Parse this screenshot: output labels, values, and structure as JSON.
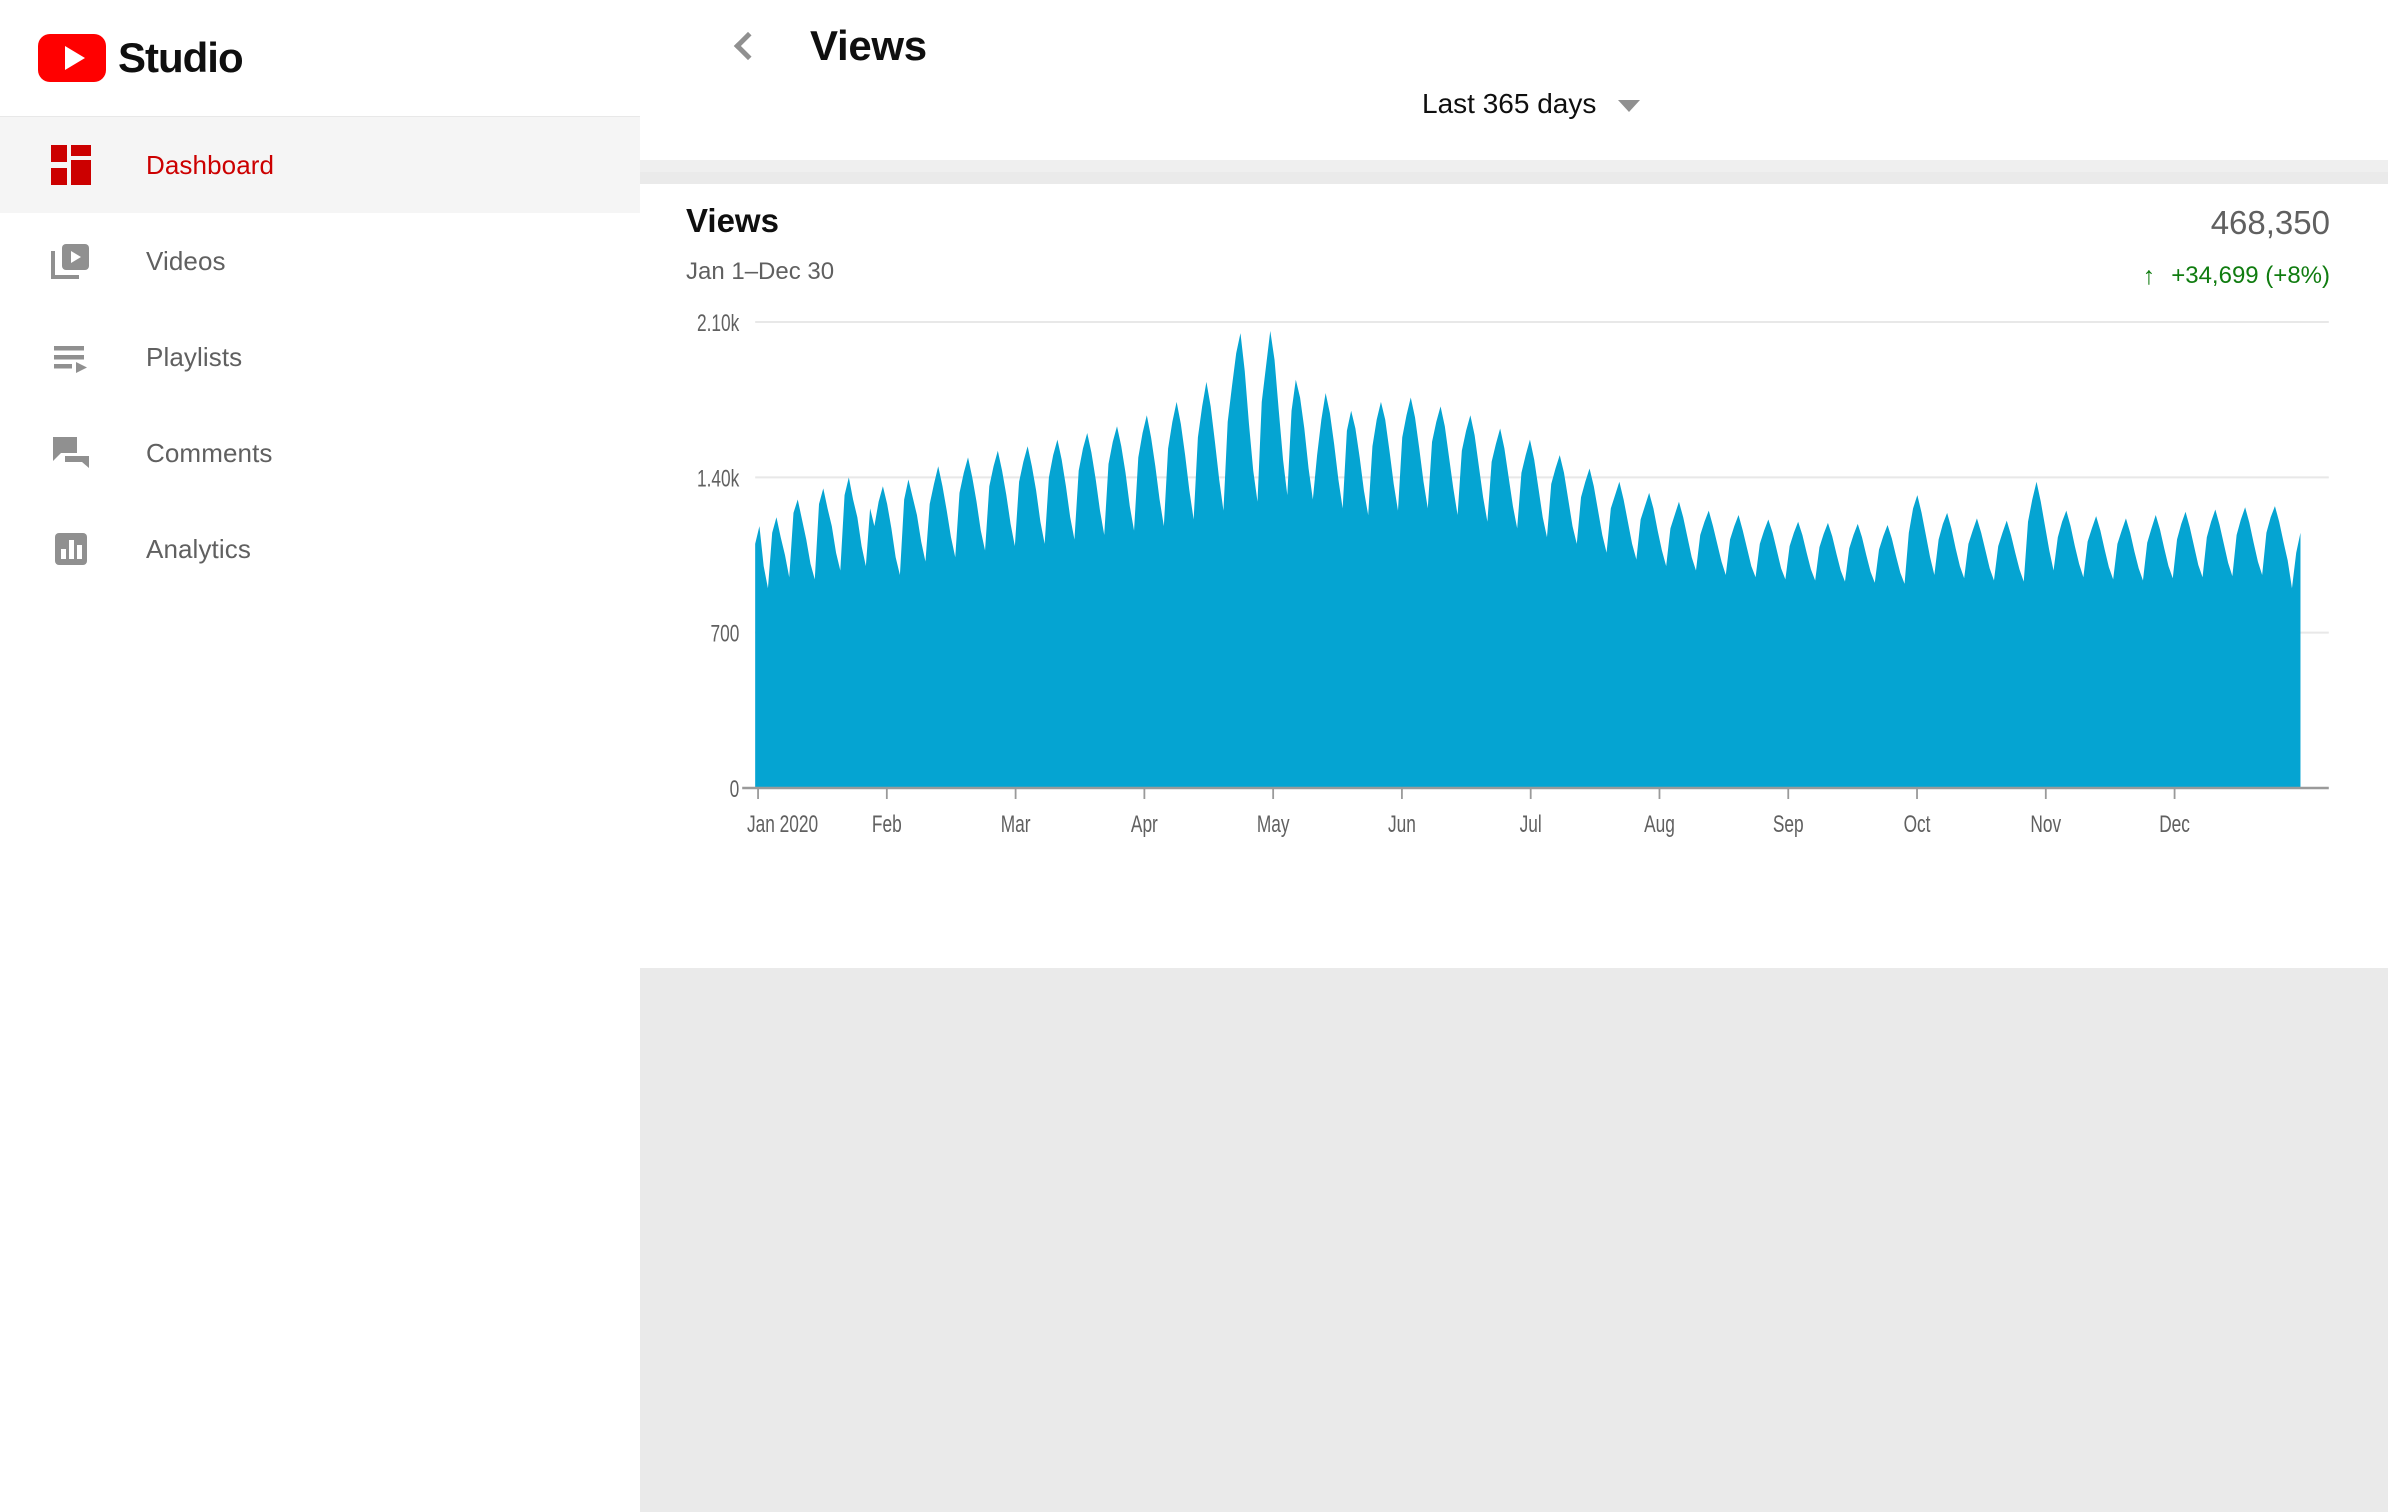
{
  "brand": {
    "name": "Studio",
    "logo_icon": "youtube-play-logo",
    "color": "#ff0000"
  },
  "sidebar": {
    "items": [
      {
        "label": "Dashboard",
        "icon": "dashboard-grid-icon",
        "active": true
      },
      {
        "label": "Videos",
        "icon": "videos-icon",
        "active": false
      },
      {
        "label": "Playlists",
        "icon": "playlists-icon",
        "active": false
      },
      {
        "label": "Comments",
        "icon": "comments-icon",
        "active": false
      },
      {
        "label": "Analytics",
        "icon": "analytics-bar-icon",
        "active": false
      }
    ],
    "active_color": "#cc0000",
    "inactive_color": "#606060"
  },
  "header": {
    "back_icon": "chevron-left-icon",
    "title": "Views",
    "date_range": {
      "label": "Last 365 days",
      "caret_icon": "chevron-down-icon"
    }
  },
  "card": {
    "metric_name": "Views",
    "date_subtitle": "Jan 1–Dec 30",
    "total": "468,350",
    "delta": "+34,699 (+8%)",
    "delta_arrow": "↑",
    "delta_color": "#107c10",
    "series_color": "#05a4d2"
  },
  "chart_data": {
    "type": "area",
    "title": "Views",
    "subtitle": "Jan 1–Dec 30",
    "xlabel": "",
    "ylabel": "",
    "ylim": [
      0,
      2100
    ],
    "grid": true,
    "legend": "none",
    "series_color": "#05a4d2",
    "ytick_labels": [
      "0",
      "700",
      "1.40k",
      "2.10k"
    ],
    "ytick_values": [
      0,
      700,
      1400,
      2100
    ],
    "xtick_labels": [
      "Jan 2020",
      "Feb",
      "Mar",
      "Apr",
      "May",
      "Jun",
      "Jul",
      "Aug",
      "Sep",
      "Oct",
      "Nov",
      "Dec"
    ],
    "x_note": "Daily views, 365 days, strong weekly cycle (weekday peaks / weekend troughs)",
    "total_views": 468350,
    "values": [
      1100,
      1180,
      1000,
      900,
      1150,
      1220,
      1130,
      1050,
      950,
      1240,
      1300,
      1210,
      1120,
      1010,
      940,
      1280,
      1350,
      1260,
      1180,
      1060,
      980,
      1320,
      1400,
      1300,
      1220,
      1090,
      1000,
      1260,
      1180,
      1290,
      1360,
      1280,
      1170,
      1040,
      960,
      1300,
      1390,
      1310,
      1230,
      1110,
      1020,
      1280,
      1370,
      1450,
      1360,
      1250,
      1130,
      1040,
      1330,
      1420,
      1490,
      1400,
      1290,
      1160,
      1070,
      1360,
      1450,
      1520,
      1430,
      1320,
      1190,
      1090,
      1380,
      1470,
      1540,
      1450,
      1340,
      1200,
      1100,
      1400,
      1500,
      1570,
      1480,
      1360,
      1220,
      1120,
      1430,
      1530,
      1600,
      1510,
      1390,
      1250,
      1140,
      1460,
      1560,
      1630,
      1540,
      1420,
      1270,
      1160,
      1490,
      1600,
      1680,
      1580,
      1450,
      1300,
      1180,
      1530,
      1650,
      1740,
      1640,
      1500,
      1340,
      1210,
      1580,
      1720,
      1830,
      1720,
      1560,
      1390,
      1250,
      1650,
      1810,
      1960,
      2050,
      1880,
      1640,
      1430,
      1290,
      1740,
      1900,
      2060,
      1930,
      1700,
      1480,
      1320,
      1700,
      1840,
      1760,
      1620,
      1440,
      1300,
      1500,
      1660,
      1780,
      1690,
      1550,
      1390,
      1260,
      1610,
      1700,
      1620,
      1490,
      1340,
      1230,
      1540,
      1660,
      1740,
      1660,
      1520,
      1370,
      1250,
      1580,
      1680,
      1760,
      1670,
      1530,
      1380,
      1260,
      1560,
      1650,
      1720,
      1630,
      1490,
      1350,
      1230,
      1520,
      1610,
      1680,
      1590,
      1450,
      1310,
      1200,
      1470,
      1550,
      1620,
      1530,
      1400,
      1270,
      1170,
      1420,
      1500,
      1570,
      1480,
      1350,
      1220,
      1130,
      1370,
      1440,
      1500,
      1420,
      1300,
      1180,
      1100,
      1310,
      1380,
      1440,
      1360,
      1250,
      1140,
      1060,
      1260,
      1320,
      1380,
      1300,
      1200,
      1100,
      1030,
      1210,
      1270,
      1330,
      1260,
      1160,
      1070,
      1000,
      1170,
      1230,
      1290,
      1220,
      1130,
      1040,
      980,
      1140,
      1200,
      1250,
      1180,
      1100,
      1020,
      960,
      1120,
      1180,
      1230,
      1160,
      1080,
      1000,
      950,
      1100,
      1160,
      1210,
      1150,
      1070,
      990,
      940,
      1090,
      1150,
      1200,
      1140,
      1060,
      985,
      935,
      1085,
      1145,
      1195,
      1135,
      1055,
      980,
      930,
      1080,
      1140,
      1190,
      1130,
      1050,
      975,
      925,
      1075,
      1135,
      1185,
      1125,
      1045,
      970,
      920,
      1150,
      1260,
      1320,
      1240,
      1140,
      1040,
      960,
      1120,
      1190,
      1240,
      1170,
      1080,
      1000,
      945,
      1100,
      1160,
      1215,
      1150,
      1070,
      990,
      935,
      1090,
      1150,
      1205,
      1140,
      1060,
      985,
      930,
      1200,
      1300,
      1380,
      1290,
      1180,
      1070,
      980,
      1130,
      1200,
      1250,
      1180,
      1090,
      1010,
      950,
      1110,
      1170,
      1225,
      1160,
      1075,
      995,
      940,
      1100,
      1160,
      1215,
      1150,
      1065,
      990,
      935,
      1105,
      1170,
      1230,
      1165,
      1080,
      1000,
      945,
      1120,
      1190,
      1245,
      1175,
      1090,
      1005,
      950,
      1130,
      1200,
      1255,
      1185,
      1100,
      1015,
      955,
      1140,
      1210,
      1265,
      1195,
      1105,
      1020,
      960,
      1150,
      1220,
      1270,
      1200,
      1110,
      1025,
      900,
      1060,
      1150
    ]
  }
}
